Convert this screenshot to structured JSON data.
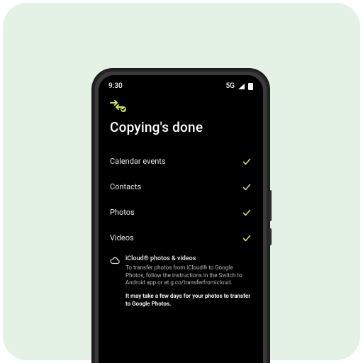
{
  "colors": {
    "backdrop": "#e4f2e5",
    "accent": "#c9e45a"
  },
  "status": {
    "time": "9:30",
    "network": "5G"
  },
  "header": {
    "title": "Copying's done"
  },
  "items": [
    {
      "label": "Calendar events",
      "done": true
    },
    {
      "label": "Contacts",
      "done": true
    },
    {
      "label": "Photos",
      "done": true
    },
    {
      "label": "Videos",
      "done": true
    }
  ],
  "icloud": {
    "title": "iCloud® photos & videos",
    "body": "To transfer photos from iCloud® to Google Photos, follow the instructions in the Switch to Android app or at g.co/transferfromicloud.",
    "footer": "It may take a few days for your photos to transfer to Google Photos."
  }
}
